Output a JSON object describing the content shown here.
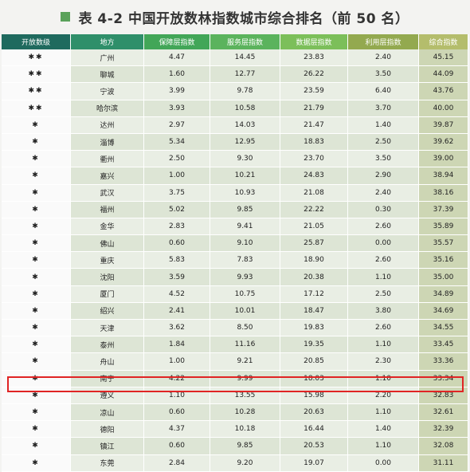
{
  "title": {
    "text": "表 4-2  中国开放数林指数城市综合排名（前 50 名）"
  },
  "accent_color": "#5aa25a",
  "highlight_color": "#e02424",
  "headers": [
    "开放数级",
    "地方",
    "保障层指数",
    "服务层指数",
    "数据层指数",
    "利用层指数",
    "综合指数"
  ],
  "rows": [
    {
      "level": "✱✱",
      "city": "广州",
      "v1": "4.47",
      "v2": "14.45",
      "v3": "23.83",
      "v4": "2.40",
      "total": "45.15"
    },
    {
      "level": "✱✱",
      "city": "聊城",
      "v1": "1.60",
      "v2": "12.77",
      "v3": "26.22",
      "v4": "3.50",
      "total": "44.09"
    },
    {
      "level": "✱✱",
      "city": "宁波",
      "v1": "3.99",
      "v2": "9.78",
      "v3": "23.59",
      "v4": "6.40",
      "total": "43.76"
    },
    {
      "level": "✱✱",
      "city": "哈尔滨",
      "v1": "3.93",
      "v2": "10.58",
      "v3": "21.79",
      "v4": "3.70",
      "total": "40.00"
    },
    {
      "level": "✱",
      "city": "达州",
      "v1": "2.97",
      "v2": "14.03",
      "v3": "21.47",
      "v4": "1.40",
      "total": "39.87"
    },
    {
      "level": "✱",
      "city": "淄博",
      "v1": "5.34",
      "v2": "12.95",
      "v3": "18.83",
      "v4": "2.50",
      "total": "39.62"
    },
    {
      "level": "✱",
      "city": "衢州",
      "v1": "2.50",
      "v2": "9.30",
      "v3": "23.70",
      "v4": "3.50",
      "total": "39.00"
    },
    {
      "level": "✱",
      "city": "嘉兴",
      "v1": "1.00",
      "v2": "10.21",
      "v3": "24.83",
      "v4": "2.90",
      "total": "38.94"
    },
    {
      "level": "✱",
      "city": "武汉",
      "v1": "3.75",
      "v2": "10.93",
      "v3": "21.08",
      "v4": "2.40",
      "total": "38.16"
    },
    {
      "level": "✱",
      "city": "福州",
      "v1": "5.02",
      "v2": "9.85",
      "v3": "22.22",
      "v4": "0.30",
      "total": "37.39"
    },
    {
      "level": "✱",
      "city": "金华",
      "v1": "2.83",
      "v2": "9.41",
      "v3": "21.05",
      "v4": "2.60",
      "total": "35.89"
    },
    {
      "level": "✱",
      "city": "佛山",
      "v1": "0.60",
      "v2": "9.10",
      "v3": "25.87",
      "v4": "0.00",
      "total": "35.57"
    },
    {
      "level": "✱",
      "city": "重庆",
      "v1": "5.83",
      "v2": "7.83",
      "v3": "18.90",
      "v4": "2.60",
      "total": "35.16"
    },
    {
      "level": "✱",
      "city": "沈阳",
      "v1": "3.59",
      "v2": "9.93",
      "v3": "20.38",
      "v4": "1.10",
      "total": "35.00"
    },
    {
      "level": "✱",
      "city": "厦门",
      "v1": "4.52",
      "v2": "10.75",
      "v3": "17.12",
      "v4": "2.50",
      "total": "34.89"
    },
    {
      "level": "✱",
      "city": "绍兴",
      "v1": "2.41",
      "v2": "10.01",
      "v3": "18.47",
      "v4": "3.80",
      "total": "34.69"
    },
    {
      "level": "✱",
      "city": "天津",
      "v1": "3.62",
      "v2": "8.50",
      "v3": "19.83",
      "v4": "2.60",
      "total": "34.55"
    },
    {
      "level": "✱",
      "city": "泰州",
      "v1": "1.84",
      "v2": "11.16",
      "v3": "19.35",
      "v4": "1.10",
      "total": "33.45"
    },
    {
      "level": "✱",
      "city": "舟山",
      "v1": "1.00",
      "v2": "9.21",
      "v3": "20.85",
      "v4": "2.30",
      "total": "33.36"
    },
    {
      "level": "✱",
      "city": "南宁",
      "v1": "4.22",
      "v2": "9.99",
      "v3": "18.03",
      "v4": "1.10",
      "total": "33.34"
    },
    {
      "level": "✱",
      "city": "遵义",
      "v1": "1.10",
      "v2": "13.55",
      "v3": "15.98",
      "v4": "2.20",
      "total": "32.83"
    },
    {
      "level": "✱",
      "city": "凉山",
      "v1": "0.60",
      "v2": "10.28",
      "v3": "20.63",
      "v4": "1.10",
      "total": "32.61"
    },
    {
      "level": "✱",
      "city": "德阳",
      "v1": "4.37",
      "v2": "10.18",
      "v3": "16.44",
      "v4": "1.40",
      "total": "32.39"
    },
    {
      "level": "✱",
      "city": "镇江",
      "v1": "0.60",
      "v2": "9.85",
      "v3": "20.53",
      "v4": "1.10",
      "total": "32.08"
    },
    {
      "level": "✱",
      "city": "东莞",
      "v1": "2.84",
      "v2": "9.20",
      "v3": "19.07",
      "v4": "0.00",
      "total": "31.11"
    }
  ]
}
